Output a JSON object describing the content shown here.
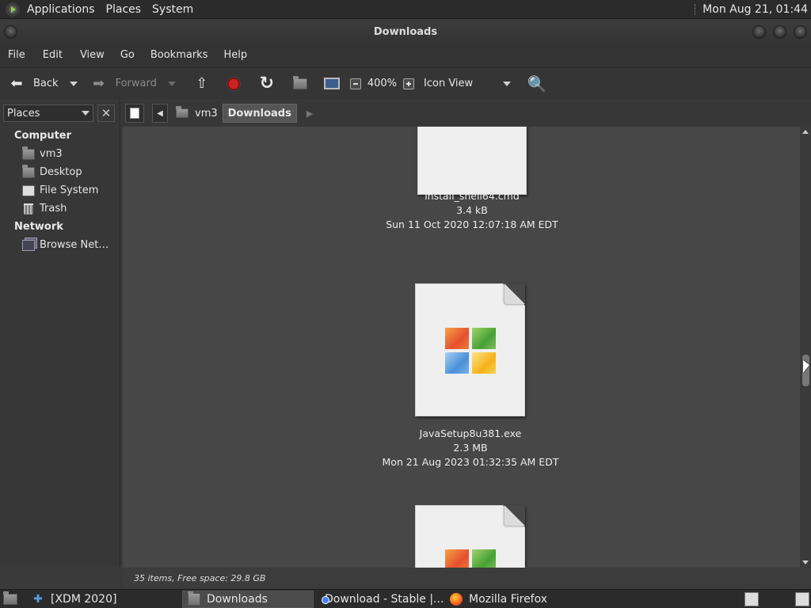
{
  "top_panel": {
    "menus": [
      "Applications",
      "Places",
      "System"
    ],
    "clock": "Mon Aug 21, 01:44"
  },
  "window": {
    "title": "Downloads"
  },
  "menubar": [
    "File",
    "Edit",
    "View",
    "Go",
    "Bookmarks",
    "Help"
  ],
  "toolbar": {
    "back_label": "Back",
    "forward_label": "Forward",
    "zoom": "400%",
    "view_mode": "Icon View"
  },
  "sidebar": {
    "selector": "Places",
    "sections": {
      "computer": "Computer",
      "network": "Network"
    },
    "computer_items": [
      "vm3",
      "Desktop",
      "File System",
      "Trash"
    ],
    "network_items": [
      "Browse Net…"
    ]
  },
  "breadcrumb": {
    "items": [
      "vm3",
      "Downloads"
    ]
  },
  "files": [
    {
      "name": "install_shell64.cmd",
      "size": "3.4 kB",
      "date": "Sun 11 Oct 2020 12:07:18 AM EDT"
    },
    {
      "name": "JavaSetup8u381.exe",
      "size": "2.3 MB",
      "date": "Mon 21 Aug 2023 01:32:35 AM EDT"
    },
    {
      "name": "",
      "size": "",
      "date": ""
    }
  ],
  "status": "35 items, Free space: 29.8 GB",
  "taskbar": {
    "items": [
      "[XDM 2020]",
      "Downloads",
      "Download - Stable |...",
      "Mozilla Firefox"
    ]
  },
  "colors": {
    "panel": "#2b2b2b",
    "content_bg": "#474747",
    "stop": "#cc2222"
  }
}
